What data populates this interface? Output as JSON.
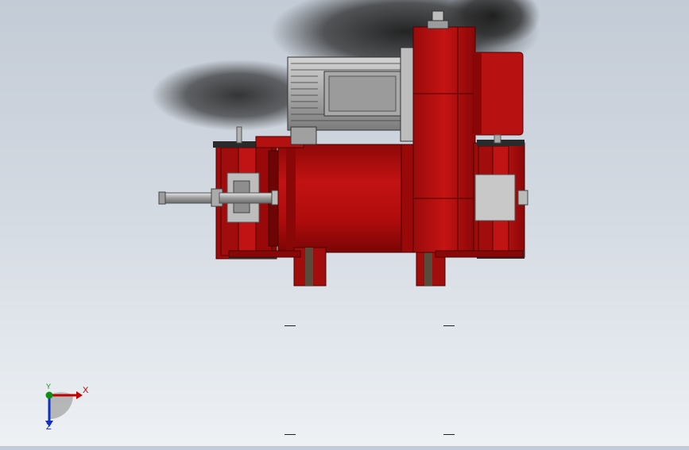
{
  "viewport": {
    "background_top": "#c3cbd6",
    "background_bottom": "#eef1f4"
  },
  "model": {
    "body_color": "#b30c0c",
    "body_dark": "#7d0606",
    "motor_color": "#9a9a9a",
    "steel_color": "#c9c9c9"
  },
  "triad": {
    "x_label": "X",
    "y_label": "Y",
    "z_label": "Z",
    "x_color": "#c00000",
    "y_color": "#109010",
    "z_color": "#1030c0"
  }
}
